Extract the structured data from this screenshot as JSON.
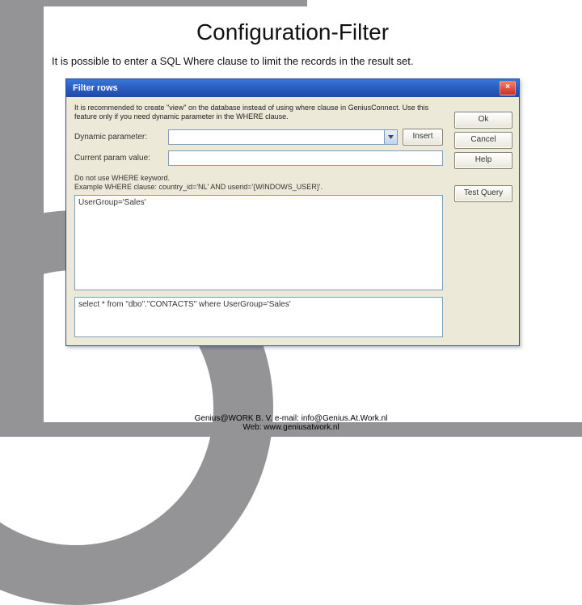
{
  "slide": {
    "title": "Configuration-Filter",
    "description": "It is possible to enter a SQL Where clause to limit the records in the result set."
  },
  "dialog": {
    "title": "Filter rows",
    "hint": "It is recommended to create \"view\" on the database instead of using where clause in GeniusConnect. Use this feature only if you need dynamic parameter in the WHERE clause.",
    "labels": {
      "dynamic_parameter": "Dynamic parameter:",
      "current_param_value": "Current param value:"
    },
    "buttons": {
      "insert": "Insert",
      "ok": "Ok",
      "cancel": "Cancel",
      "help": "Help",
      "test_query": "Test Query"
    },
    "note_line1": "Do not use WHERE keyword.",
    "note_line2": "Example WHERE clause: country_id='NL' AND userid='{WINDOWS_USER}'.",
    "where_text": "UserGroup='Sales'",
    "preview_text": "select * from \"dbo\".\"CONTACTS\" where UserGroup='Sales'"
  },
  "footer": {
    "line1": "Genius@WORK B. V.   e-mail: info@Genius.At.Work.nl",
    "line2": "Web: www.geniusatwork.nl"
  }
}
